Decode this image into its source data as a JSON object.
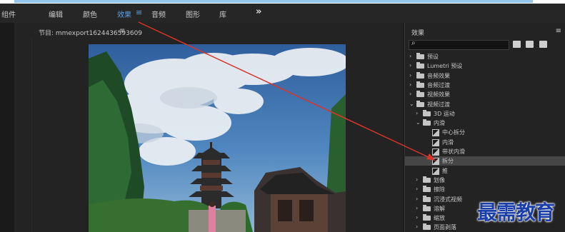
{
  "menubar": {
    "items": [
      "组件",
      "编辑",
      "颜色",
      "效果",
      "音频",
      "图形",
      "库"
    ],
    "active_index": 3,
    "more": "»",
    "menu_glyph": "≡"
  },
  "sequence": {
    "title": "节目: mmexport1624436593609",
    "menu_glyph": "≡"
  },
  "effects": {
    "title": "效果",
    "menu_glyph": "≡",
    "search_icon": "⌕",
    "search_value": "",
    "tree": [
      {
        "label": "预设",
        "level": 0,
        "expanded": false,
        "kind": "star-folder"
      },
      {
        "label": "Lumetri 预设",
        "level": 0,
        "expanded": false,
        "kind": "star-folder"
      },
      {
        "label": "音频效果",
        "level": 0,
        "expanded": false,
        "kind": "folder"
      },
      {
        "label": "音频过渡",
        "level": 0,
        "expanded": false,
        "kind": "folder"
      },
      {
        "label": "视频效果",
        "level": 0,
        "expanded": false,
        "kind": "folder"
      },
      {
        "label": "视频过渡",
        "level": 0,
        "expanded": true,
        "kind": "folder"
      },
      {
        "label": "3D 运动",
        "level": 1,
        "expanded": false,
        "kind": "folder"
      },
      {
        "label": "内滑",
        "level": 1,
        "expanded": true,
        "kind": "folder"
      },
      {
        "label": "中心拆分",
        "level": 2,
        "kind": "effect"
      },
      {
        "label": "内滑",
        "level": 2,
        "kind": "effect"
      },
      {
        "label": "带状内滑",
        "level": 2,
        "kind": "effect"
      },
      {
        "label": "拆分",
        "level": 2,
        "kind": "effect",
        "selected": true
      },
      {
        "label": "推",
        "level": 2,
        "kind": "effect"
      },
      {
        "label": "划像",
        "level": 1,
        "expanded": false,
        "kind": "folder"
      },
      {
        "label": "擦除",
        "level": 1,
        "expanded": false,
        "kind": "folder"
      },
      {
        "label": "沉浸式视频",
        "level": 1,
        "expanded": false,
        "kind": "folder"
      },
      {
        "label": "溶解",
        "level": 1,
        "expanded": false,
        "kind": "folder"
      },
      {
        "label": "缩放",
        "level": 1,
        "expanded": false,
        "kind": "folder"
      },
      {
        "label": "页面剥落",
        "level": 1,
        "expanded": false,
        "kind": "folder"
      }
    ]
  },
  "watermark": "最需教育",
  "colors": {
    "accent_blue": "#5aa2e6",
    "annotation_red": "#d9342b",
    "watermark_blue": "#1b3fa8"
  }
}
